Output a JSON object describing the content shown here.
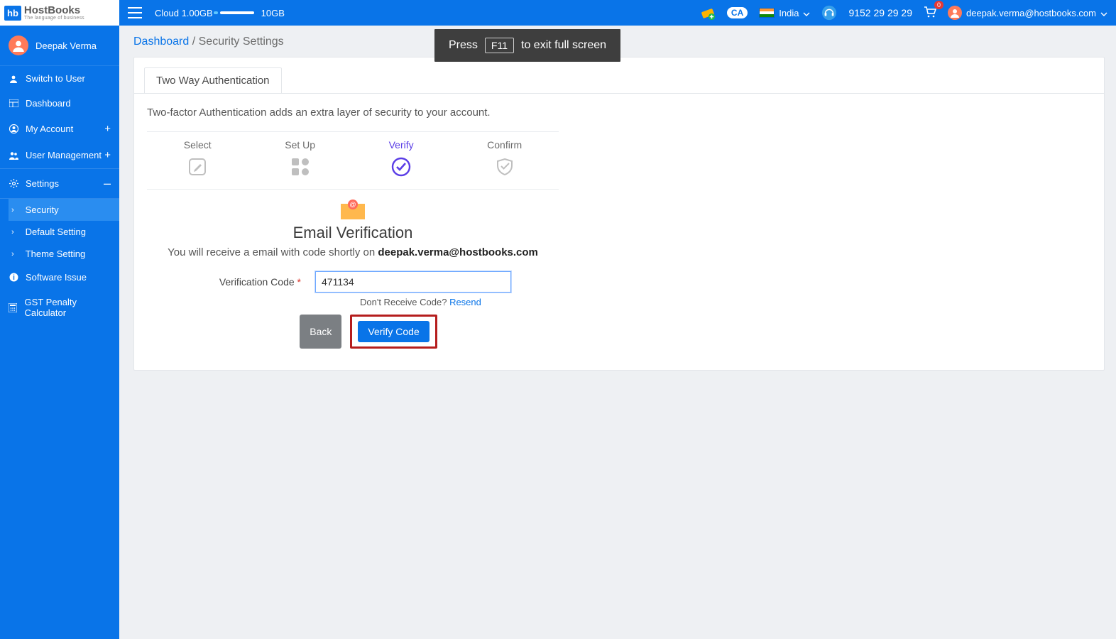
{
  "brand": {
    "hb": "hb",
    "name": "HostBooks",
    "tagline": "The language of business"
  },
  "topbar": {
    "cloud_label": "Cloud 1.00GB",
    "cloud_total": "10GB",
    "ca_badge": "CA",
    "country": "India",
    "phone": "9152 29 29 29",
    "cart_count": "0",
    "user_email": "deepak.verma@hostbooks.com"
  },
  "sidebar": {
    "user_name": "Deepak Verma",
    "items": {
      "switch": "Switch to User",
      "dashboard": "Dashboard",
      "myaccount": "My Account",
      "usermgmt": "User Management",
      "settings": "Settings",
      "security": "Security",
      "defaultsetting": "Default Setting",
      "themesetting": "Theme Setting",
      "softwareissue": "Software Issue",
      "gst": "GST Penalty Calculator"
    }
  },
  "breadcrumb": {
    "root": "Dashboard",
    "sep": " / ",
    "current": "Security Settings"
  },
  "tab": {
    "two_way": "Two Way Authentication"
  },
  "description": "Two-factor Authentication adds an extra layer of security to your account.",
  "steps": {
    "select": "Select",
    "setup": "Set Up",
    "verify": "Verify",
    "confirm": "Confirm"
  },
  "verify": {
    "title": "Email Verification",
    "sub_pre": "You will receive a email with code shortly on ",
    "sub_email": "deepak.verma@hostbooks.com",
    "label": "Verification Code ",
    "code_value": "471134",
    "noreceive": "Don't Receive Code? ",
    "resend": "Resend",
    "btn_back": "Back",
    "btn_verify": "Verify Code"
  },
  "fs": {
    "pre": "Press",
    "key": "F11",
    "post": "to exit full screen"
  }
}
